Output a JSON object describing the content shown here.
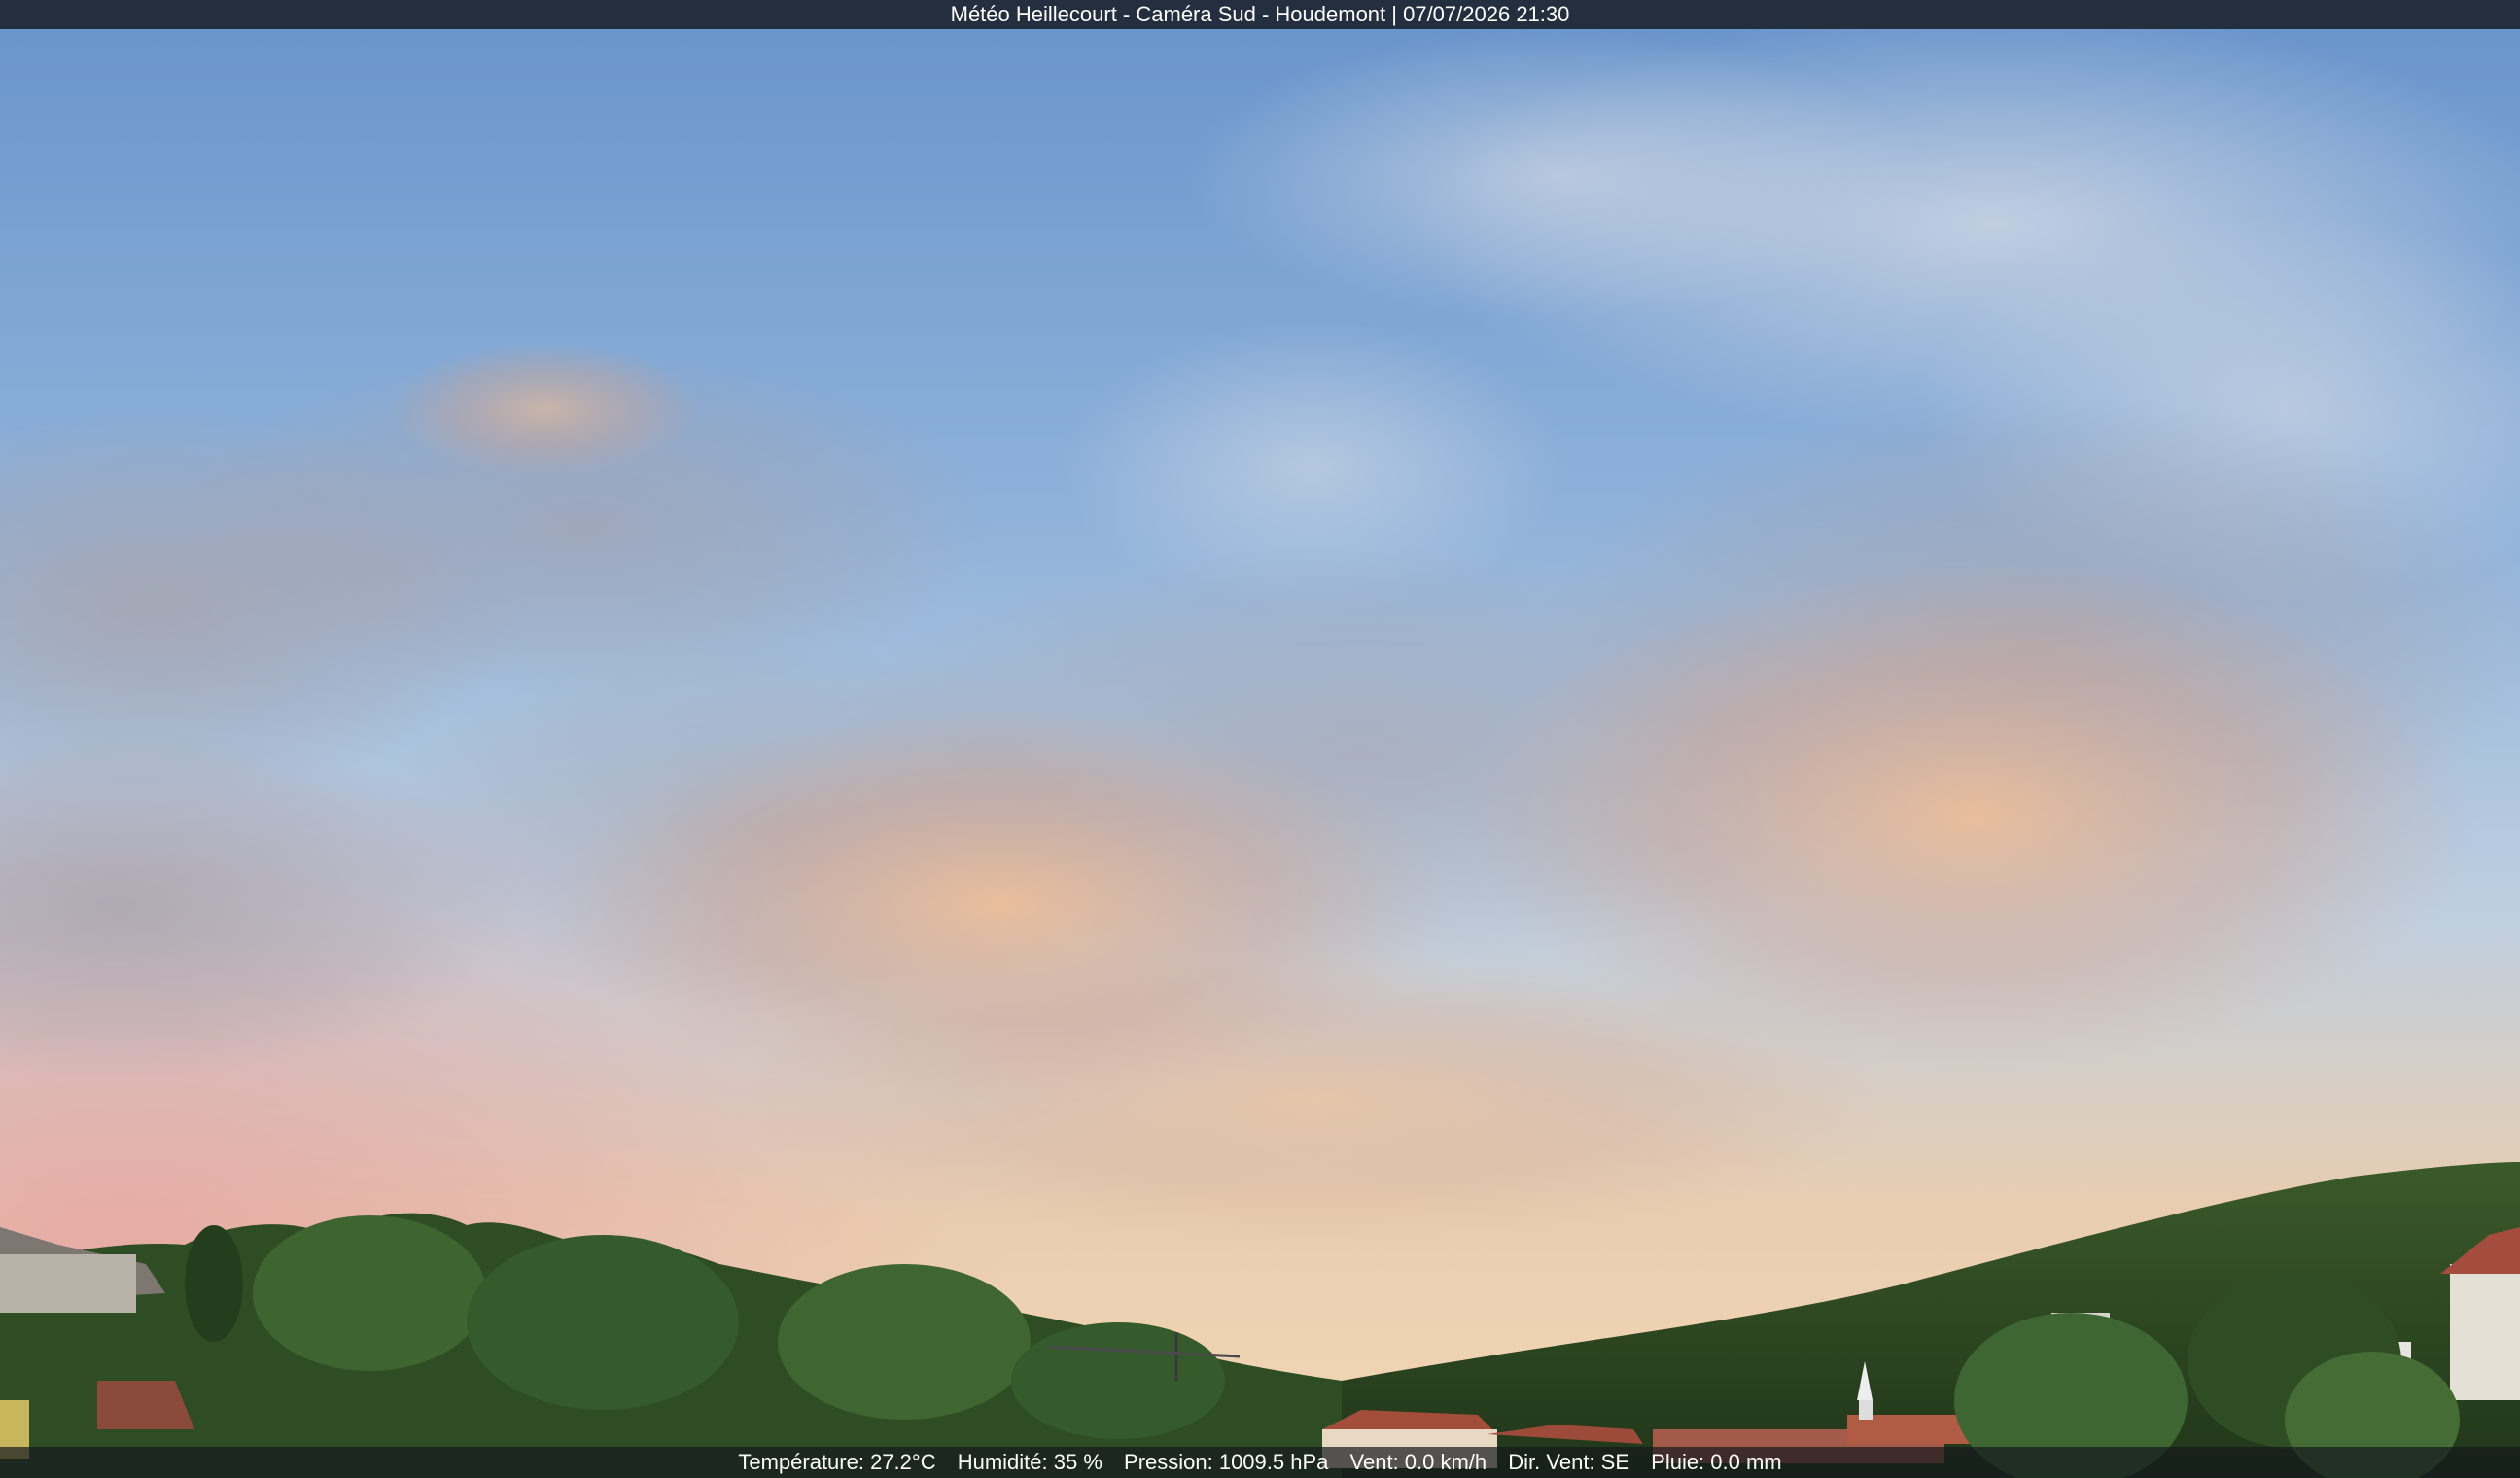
{
  "header": {
    "title": "Météo Heillecourt - Caméra Sud - Houdemont | 07/07/2026 21:30"
  },
  "weather": {
    "temperature": "Température: 27.2°C",
    "humidity": "Humidité: 35 %",
    "pressure": "Pression: 1009.5 hPa",
    "wind": "Vent: 0.0 km/h",
    "wind_direction": "Dir. Vent: SE",
    "rain": "Pluie: 0.0 mm"
  },
  "colors": {
    "sky_top": "#6f9bd0",
    "sky_mid": "#a9c4e0",
    "horizon_warm": "#f0c9a4",
    "horizon_pink": "#e6a9a4",
    "cloud_warm": "#e9b48f",
    "cloud_grey": "#a9a2a6",
    "trees": "#2f4a22",
    "roofs": "#9a4a38",
    "overlay_bar": "#14181e"
  }
}
